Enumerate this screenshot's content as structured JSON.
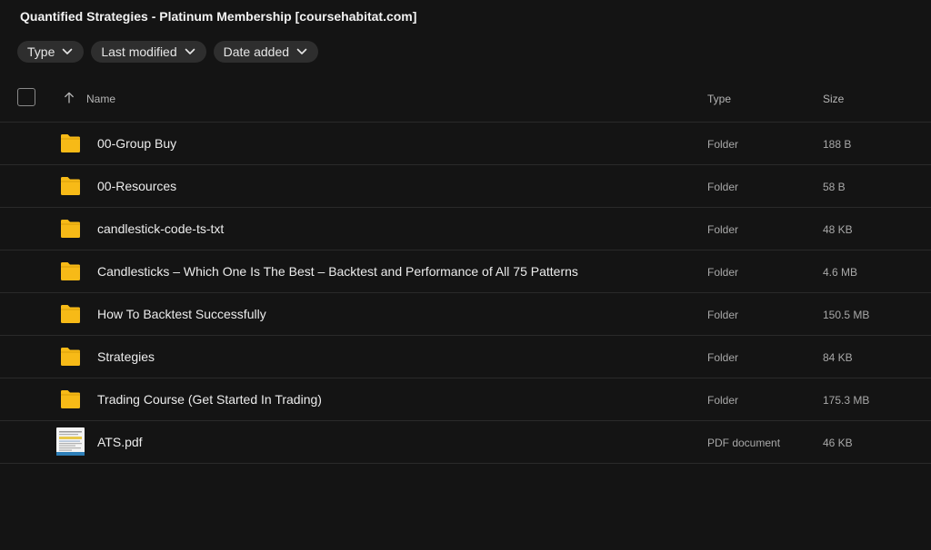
{
  "header": {
    "title": "Quantified Strategies - Platinum Membership [coursehabitat.com]"
  },
  "filters": [
    {
      "label": "Type"
    },
    {
      "label": "Last modified"
    },
    {
      "label": "Date added"
    }
  ],
  "columns": {
    "name": "Name",
    "type": "Type",
    "size": "Size"
  },
  "sort": {
    "column": "Name",
    "direction": "ascending"
  },
  "colors": {
    "folder": "#f7ba17",
    "background": "#141414",
    "chip": "#2e2e2e"
  },
  "files": [
    {
      "name": "00-Group Buy",
      "type": "Folder",
      "size": "188 B",
      "icon": "folder-icon"
    },
    {
      "name": "00-Resources",
      "type": "Folder",
      "size": "58 B",
      "icon": "folder-icon"
    },
    {
      "name": "candlestick-code-ts-txt",
      "type": "Folder",
      "size": "48 KB",
      "icon": "folder-icon"
    },
    {
      "name": "Candlesticks – Which One Is The Best – Backtest and Performance of All 75 Patterns",
      "type": "Folder",
      "size": "4.6 MB",
      "icon": "folder-icon"
    },
    {
      "name": "How To Backtest Successfully",
      "type": "Folder",
      "size": "150.5 MB",
      "icon": "folder-icon"
    },
    {
      "name": "Strategies",
      "type": "Folder",
      "size": "84 KB",
      "icon": "folder-icon"
    },
    {
      "name": "Trading Course (Get Started In Trading)",
      "type": "Folder",
      "size": "175.3 MB",
      "icon": "folder-icon"
    },
    {
      "name": "ATS.pdf",
      "type": "PDF document",
      "size": "46 KB",
      "icon": "pdf-thumbnail-icon"
    }
  ]
}
